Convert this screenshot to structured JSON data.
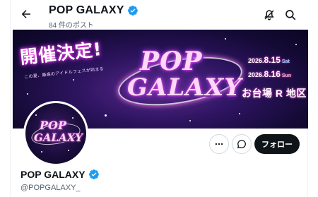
{
  "header": {
    "name": "POP GALAXY",
    "post_count": "84 件のポスト"
  },
  "banner": {
    "headline": "開催決定!",
    "subline": "この夏、最高のアイドルフェスが始まる",
    "logo_line1": "POP",
    "logo_line2": "GALAXY",
    "date1_year": "2026.",
    "date1_md": "8.15",
    "date1_dow": "Sat",
    "date2_year": "2026.",
    "date2_md": "8.16",
    "date2_dow": "Sun",
    "venue": "お台場 R 地区"
  },
  "avatar": {
    "logo_line1": "POP",
    "logo_line2": "GALAXY"
  },
  "actions": {
    "follow_label": "フォロー"
  },
  "profile": {
    "name": "POP GALAXY",
    "handle": "@POPGALAXY_"
  },
  "colors": {
    "verified": "#1d9bf0",
    "follow_bg": "#0f1419",
    "banner_glow": "#ff4fd9"
  },
  "icons": {
    "back": "arrow-left-icon",
    "verified": "verified-badge-icon",
    "notify_off": "bell-off-icon",
    "search": "search-icon",
    "more": "more-horizontal-icon",
    "message": "message-icon"
  }
}
